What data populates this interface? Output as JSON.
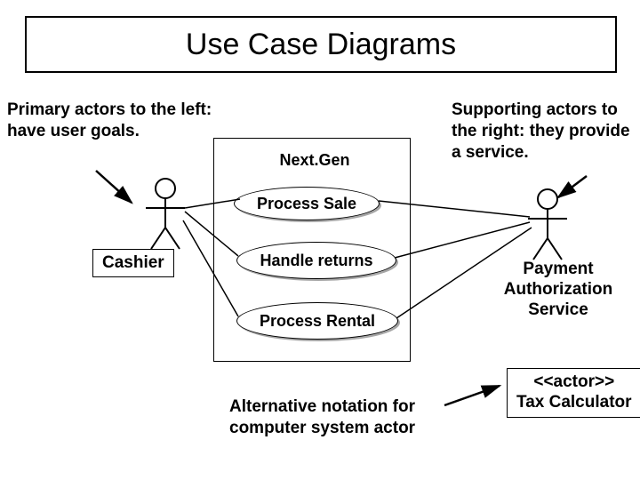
{
  "title": "Use Case Diagrams",
  "notes": {
    "primary": "Primary actors to the left: have user goals.",
    "supporting": "Supporting actors to the right: they provide a service.",
    "alternative": "Alternative notation for computer system actor"
  },
  "system": {
    "name": "Next.Gen"
  },
  "usecases": {
    "process_sale": "Process Sale",
    "handle_returns": "Handle returns",
    "process_rental": "Process Rental"
  },
  "actors": {
    "cashier": "Cashier",
    "payment_auth": "Payment Authorization Service",
    "tax_calculator": "<<actor>>\nTax Calculator"
  }
}
